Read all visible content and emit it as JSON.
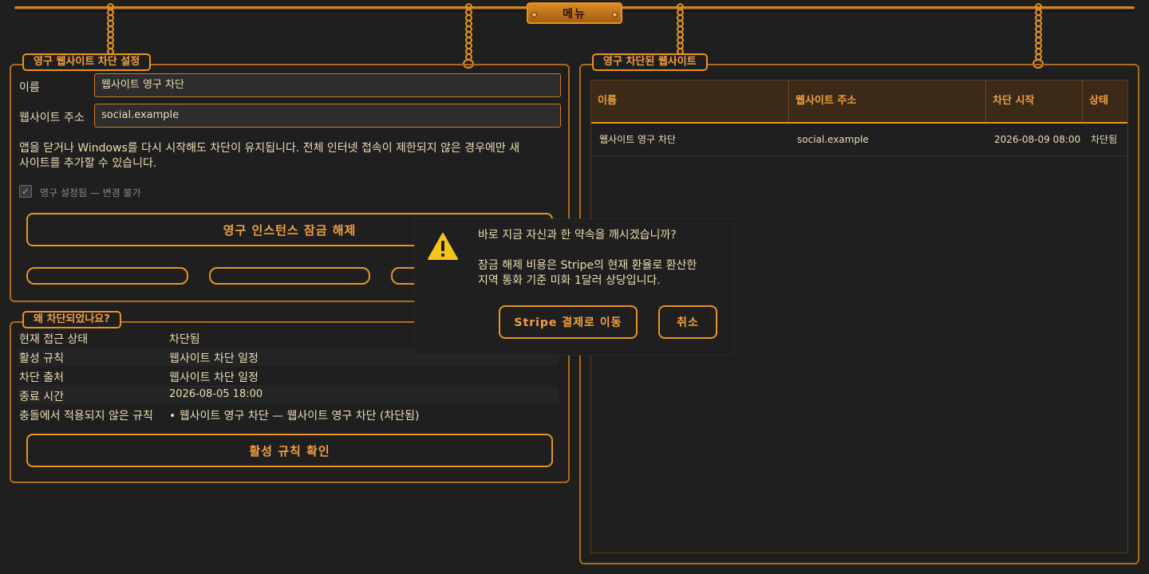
{
  "menu": {
    "label": "메뉴"
  },
  "settings_panel": {
    "legend": "영구 웹사이트 차단 설정",
    "name_label": "이름",
    "name_value": "웹사이트 영구 차단",
    "url_label": "웹사이트 주소",
    "url_value": "social.example",
    "note_line1": "앱을 닫거나 Windows를 다시 시작해도 차단이 유지됩니다. 전체 인터넷 접속이 제한되지 않은 경우에만 새",
    "note_line2": "사이트를 추가할 수 있습니다.",
    "permanent_checkbox_label": "영구 설정됨 — 변경 불가",
    "permanent_checked": true,
    "unlock_button": "영구 인스턴스 잠금 해제"
  },
  "why_panel": {
    "legend": "왜 차단되었나요?",
    "rows": [
      {
        "key": "현재 접근 상태",
        "value": "차단됨"
      },
      {
        "key": "활성 규칙",
        "value": "웹사이트 차단 일정"
      },
      {
        "key": "차단 출처",
        "value": "웹사이트 차단 일정"
      },
      {
        "key": "종료 시간",
        "value": "2026-08-05 18:00"
      },
      {
        "key": "충돌에서 적용되지 않은 규칙",
        "value": "• 웹사이트 영구 차단 — 웹사이트 영구 차단 (차단됨)"
      }
    ],
    "check_button": "활성 규칙 확인"
  },
  "blocked_panel": {
    "legend": "영구 차단된 웹사이트",
    "columns": [
      "이름",
      "웹사이트 주소",
      "차단 시작",
      "상태"
    ],
    "rows": [
      {
        "name": "웹사이트 영구 차단",
        "url": "social.example",
        "start": "2026-08-09 08:00",
        "status": "차단됨"
      }
    ]
  },
  "dialog": {
    "icon": "warning-icon",
    "question": "바로 지금 자신과 한 약속을 깨시겠습니까?",
    "detail_line1": "잠금 해제 비용은 Stripe의 현재 환율로 환산한",
    "detail_line2": "지역 통화 기준 미화 1달러 상당입니다.",
    "confirm_button": "Stripe 결제로 이동",
    "cancel_button": "취소"
  },
  "colors": {
    "accent": "#e8941f",
    "background": "#1f1f1f",
    "text": "#ecdcb4",
    "warning": "#f5c518"
  }
}
